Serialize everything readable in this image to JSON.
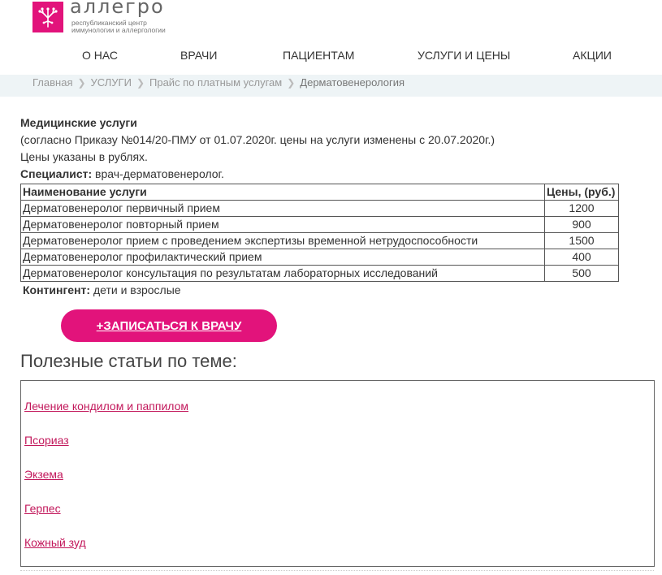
{
  "logo": {
    "name": "аллегро",
    "subtitle_line1": "республиканский центр",
    "subtitle_line2": "иммунологии и аллергологии",
    "icon": "branch-logo-icon",
    "color": "#e2137b"
  },
  "nav": {
    "items": [
      "О НАС",
      "ВРАЧИ",
      "ПАЦИЕНТАМ",
      "УСЛУГИ И ЦЕНЫ",
      "АКЦИИ"
    ]
  },
  "breadcrumb": {
    "items": [
      "Главная",
      "УСЛУГИ",
      "Прайс по платным услугам"
    ],
    "current": "Дерматовенерология",
    "separator_icon": "chevron-right-icon"
  },
  "content": {
    "title": "Медицинские услуги",
    "order_note": "(согласно Приказу №014/20-ПМУ от 01.07.2020г. цены на услуги изменены с 20.07.2020г.)",
    "currency_note": "Цены указаны в рублях.",
    "specialist_label": "Специалист:",
    "specialist_value": " врач-дерматовенеролог.",
    "table": {
      "headers": [
        "Наименование услуги",
        "Цены, (руб.)"
      ],
      "rows": [
        {
          "name": "Дерматовенеролог первичный прием",
          "price": "1200"
        },
        {
          "name": "Дерматовенеролог повторный прием",
          "price": "900"
        },
        {
          "name": "Дерматовенеролог прием с проведением экспертизы временной нетрудоспособности",
          "price": "1500"
        },
        {
          "name": "Дерматовенеролог профилактический прием",
          "price": "400"
        },
        {
          "name": "Дерматовенеролог консультация по результатам лабораторных исследований",
          "price": "500"
        }
      ]
    },
    "contingent_label": "Контингент:",
    "contingent_value": " дети и взрослые"
  },
  "appointment_button": {
    "label": "+ЗАПИСАТЬСЯ К ВРАЧУ",
    "color": "#e2137b"
  },
  "articles": {
    "title": "Полезные статьи по теме:",
    "links": [
      "Лечение кондилом и паппилом",
      "Псориаз",
      "Экзема",
      "Герпес",
      "Кожный зуд"
    ],
    "link_color": "#c2185b"
  }
}
